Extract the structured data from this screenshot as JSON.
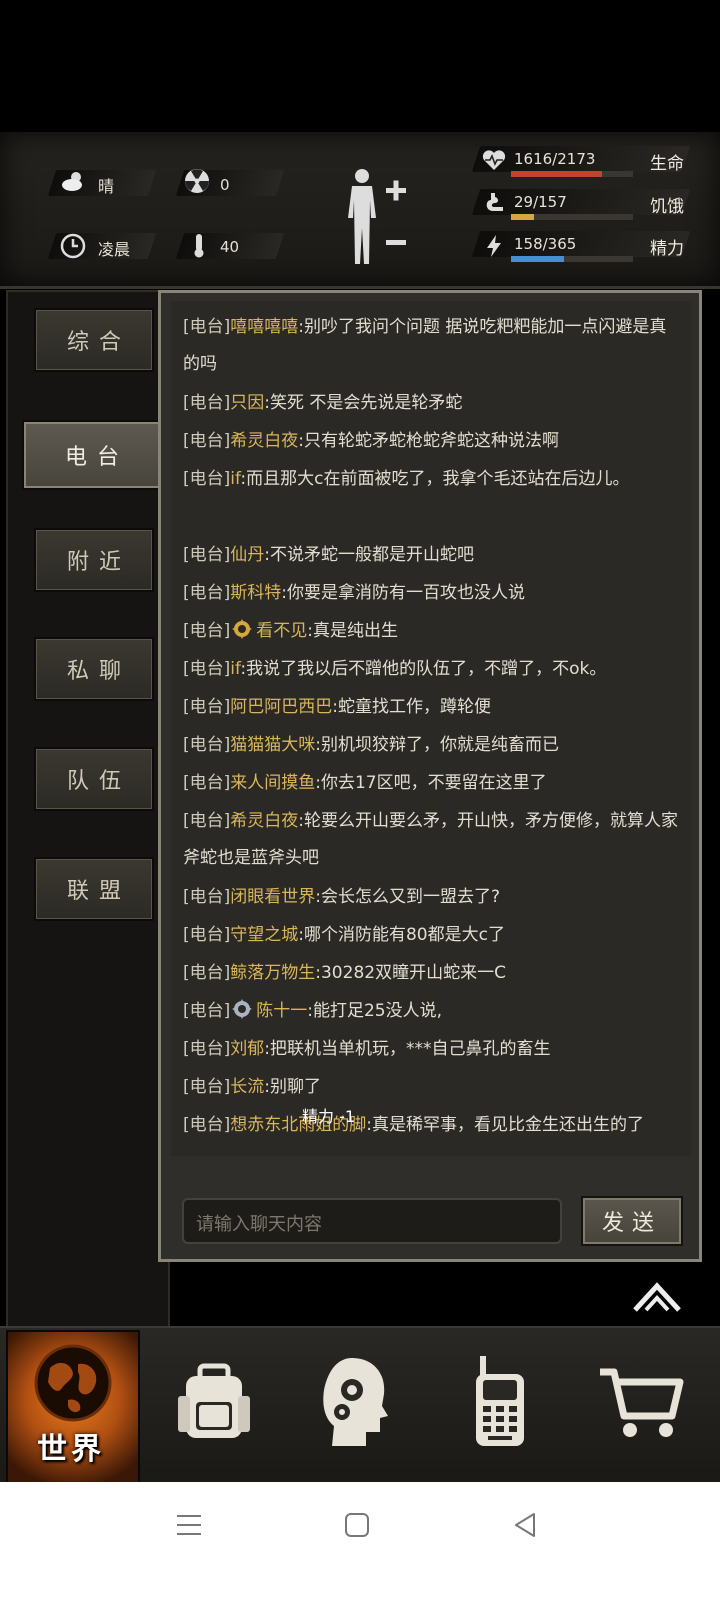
{
  "hud": {
    "weather": "晴",
    "radiation": "0",
    "time_of_day": "凌晨",
    "temperature": "40",
    "stats": [
      {
        "name": "生命",
        "value": "1616/2173",
        "fraction": 0.744,
        "color": "#c8412e",
        "icon": "heart-icon"
      },
      {
        "name": "饥饿",
        "value": "29/157",
        "fraction": 0.185,
        "color": "#d6a640",
        "icon": "stomach-icon"
      },
      {
        "name": "精力",
        "value": "158/365",
        "fraction": 0.433,
        "color": "#4a8ecf",
        "icon": "energy-icon"
      }
    ]
  },
  "tabs": [
    {
      "label": "综合",
      "active": false
    },
    {
      "label": "电台",
      "active": true
    },
    {
      "label": "附近",
      "active": false
    },
    {
      "label": "私聊",
      "active": false
    },
    {
      "label": "队伍",
      "active": false
    },
    {
      "label": "联盟",
      "active": false
    }
  ],
  "chat": {
    "messages": [
      {
        "tag": "[电台]",
        "nick": "嘻嘻嘻嘻",
        "text": ":别吵了我问个问题 据说吃粑粑能加一点闪避是真的吗"
      },
      {
        "tag": "[电台]",
        "nick": "只因",
        "text": ":笑死 不是会先说是轮矛蛇"
      },
      {
        "tag": "[电台]",
        "nick": "希灵白夜",
        "text": ":只有轮蛇矛蛇枪蛇斧蛇这种说法啊"
      },
      {
        "tag": "[电台]",
        "nick": "if",
        "text": ":而且那大c在前面被吃了，我拿个毛还站在后边儿。"
      },
      {
        "tag": "[电台]",
        "nick": "仙丹",
        "text": ":不说矛蛇一般都是开山蛇吧"
      },
      {
        "tag": "[电台]",
        "nick": "斯科特",
        "text": ":你要是拿消防有一百攻也没人说"
      },
      {
        "tag": "[电台]",
        "nick": "看不见",
        "text": ":真是纯出生",
        "badge": "gold"
      },
      {
        "tag": "[电台]",
        "nick": "if",
        "text": ":我说了我以后不蹭他的队伍了，不蹭了，不ok。"
      },
      {
        "tag": "[电台]",
        "nick": "阿巴阿巴西巴",
        "text": ":蛇童找工作，蹲轮便"
      },
      {
        "tag": "[电台]",
        "nick": "猫猫猫大咪",
        "text": ":别机坝狡辩了，你就是纯畜而已"
      },
      {
        "tag": "[电台]",
        "nick": "来人间摸鱼",
        "text": ":你去17区吧，不要留在这里了"
      },
      {
        "tag": "[电台]",
        "nick": "希灵白夜",
        "text": ":轮要么开山要么矛，开山快，矛方便修，就算人家斧蛇也是蓝斧头吧"
      },
      {
        "tag": "[电台]",
        "nick": "闭眼看世界",
        "text": ":会长怎么又到一盟去了?"
      },
      {
        "tag": "[电台]",
        "nick": "守望之城",
        "text": ":哪个消防能有80都是大c了"
      },
      {
        "tag": "[电台]",
        "nick": "鲸落万物生",
        "text": ":30282双瞳开山蛇来一C"
      },
      {
        "tag": "[电台]",
        "nick": "陈十一",
        "text": ":能打足25没人说,",
        "badge": "silver"
      },
      {
        "tag": "[电台]",
        "nick": "刘郁",
        "text": ":把联机当单机玩，***自己鼻孔的畜生"
      },
      {
        "tag": "[电台]",
        "nick": "长流",
        "text": ":别聊了"
      },
      {
        "tag": "[电台]",
        "nick": "想赤东北雨姐的脚",
        "text": ":真是稀罕事，看见比金生还出生的了"
      }
    ],
    "input_placeholder": "请输入聊天内容",
    "send_label": "发送",
    "float_label": "精力 -1"
  },
  "nav": {
    "world_label": "世界",
    "items": [
      "backpack-icon",
      "skills-head-icon",
      "radio-walkie-icon",
      "cart-icon"
    ]
  }
}
